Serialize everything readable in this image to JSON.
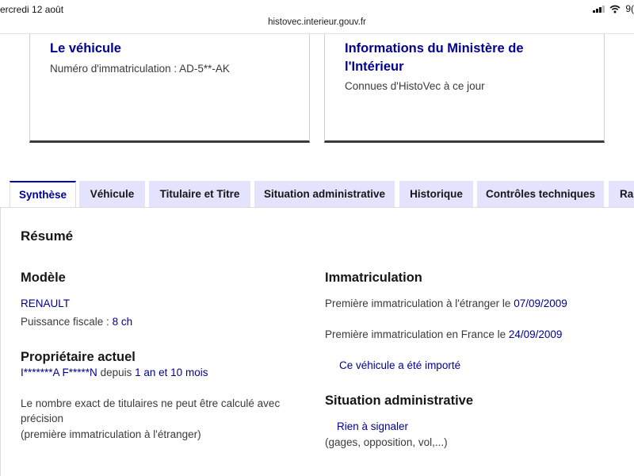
{
  "status_bar": {
    "date": "ercredi 12 août",
    "battery": "9("
  },
  "browser": {
    "url": "histovec.interieur.gouv.fr"
  },
  "cards": [
    {
      "title": "Le véhicule",
      "text": "Numéro d'immatriculation : AD-5**-AK"
    },
    {
      "title": "Informations du Ministère de l'Intérieur",
      "text": "Connues d'HistoVec à ce jour"
    }
  ],
  "tabs": [
    {
      "label": "Synthèse",
      "active": true
    },
    {
      "label": "Véhicule"
    },
    {
      "label": "Titulaire et Titre"
    },
    {
      "label": "Situation administrative"
    },
    {
      "label": "Historique"
    },
    {
      "label": "Contrôles techniques"
    },
    {
      "label": "Rap"
    }
  ],
  "summary": {
    "title": "Résumé",
    "model": {
      "heading": "Modèle",
      "brand": "RENAULT",
      "power_label": "Puissance fiscale :",
      "power_value": "8 ch"
    },
    "owner": {
      "heading": "Propriétaire actuel",
      "name": "I*******A F*****N",
      "since_label": "depuis",
      "since_value": "1 an et 10 mois",
      "note_line1": "Le nombre exact de titulaires ne peut être calculé avec",
      "note_line2": "précision",
      "note_line3": "(première immatriculation à l'étranger)"
    },
    "registration": {
      "heading": "Immatriculation",
      "foreign_label": "Première immatriculation à l'étranger le",
      "foreign_date": "07/09/2009",
      "france_label": "Première immatriculation en France le",
      "france_date": "24/09/2009",
      "imported_link": "Ce véhicule a été importé"
    },
    "admin": {
      "heading": "Situation administrative",
      "status_link": "Rien à signaler",
      "details": "(gages, opposition, vol,...)"
    }
  },
  "colors": {
    "primary": "#000091",
    "tab_bg": "#e3e3fd",
    "text": "#3a3a3a"
  }
}
